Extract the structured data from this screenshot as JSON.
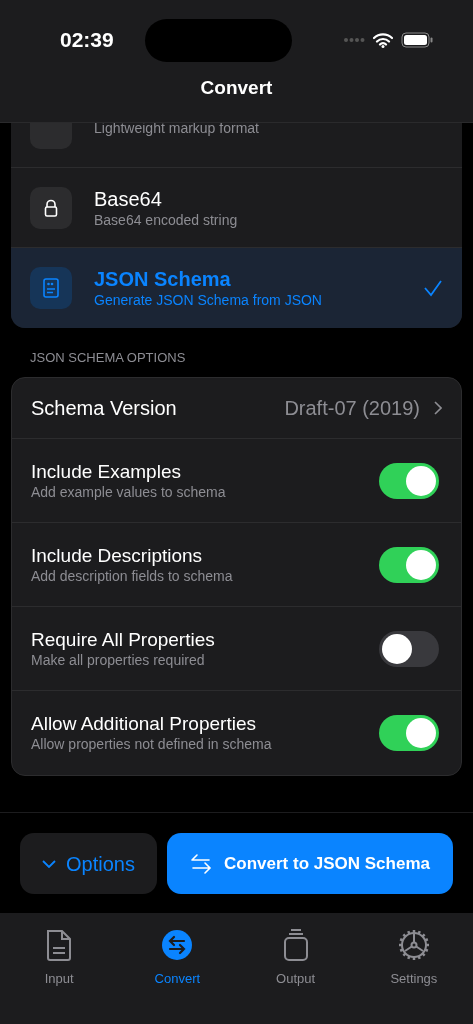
{
  "status_bar": {
    "time": "02:39"
  },
  "nav": {
    "title": "Convert"
  },
  "formats": [
    {
      "kind": "markup",
      "subtitle": "Lightweight markup format",
      "selected": false
    },
    {
      "kind": "lock",
      "title": "Base64",
      "subtitle": "Base64 encoded string",
      "selected": false
    },
    {
      "kind": "schema",
      "title": "JSON Schema",
      "subtitle": "Generate JSON Schema from JSON",
      "selected": true
    }
  ],
  "options_section": {
    "header": "JSON SCHEMA OPTIONS",
    "schema_version": {
      "label": "Schema Version",
      "value": "Draft-07 (2019)"
    },
    "toggles": [
      {
        "label": "Include Examples",
        "description": "Add example values to schema",
        "on": true
      },
      {
        "label": "Include Descriptions",
        "description": "Add description fields to schema",
        "on": true
      },
      {
        "label": "Require All Properties",
        "description": "Make all properties required",
        "on": false
      },
      {
        "label": "Allow Additional Properties",
        "description": "Allow properties not defined in schema",
        "on": true
      }
    ]
  },
  "actions": {
    "options_button": "Options",
    "convert_button": "Convert to JSON Schema"
  },
  "tabs": [
    {
      "kind": "input",
      "label": "Input",
      "selected": false
    },
    {
      "kind": "convert",
      "label": "Convert",
      "selected": true
    },
    {
      "kind": "output",
      "label": "Output",
      "selected": false
    },
    {
      "kind": "settings",
      "label": "Settings",
      "selected": false
    }
  ]
}
